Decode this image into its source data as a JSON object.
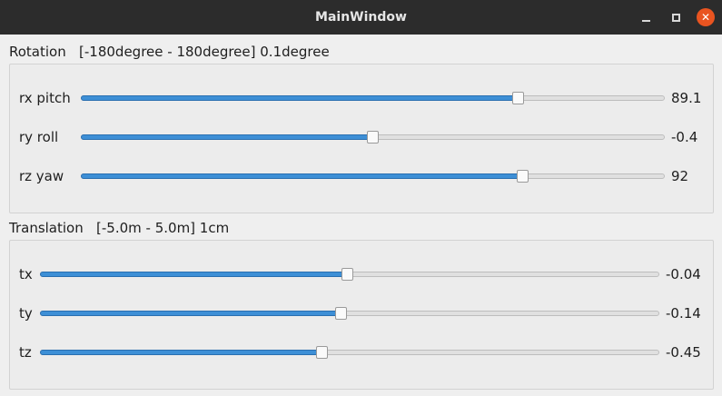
{
  "window": {
    "title": "MainWindow",
    "controls": [
      "minimize-icon",
      "maximize-icon",
      "close-icon"
    ],
    "close_glyph": "✕"
  },
  "rotation": {
    "title": "Rotation   [-180degree - 180degree] 0.1degree",
    "rows": [
      {
        "label": "rx pitch",
        "value": "89.1",
        "fraction": 0.7475
      },
      {
        "label": "ry roll",
        "value": "-0.4",
        "fraction": 0.4989
      },
      {
        "label": "rz yaw",
        "value": "92",
        "fraction": 0.7556
      }
    ]
  },
  "translation": {
    "title": "Translation   [-5.0m - 5.0m] 1cm",
    "rows": [
      {
        "label": "tx",
        "value": "-0.04",
        "fraction": 0.496
      },
      {
        "label": "ty",
        "value": "-0.14",
        "fraction": 0.486
      },
      {
        "label": "tz",
        "value": "-0.45",
        "fraction": 0.455
      }
    ]
  },
  "colors": {
    "accent": "#3d8fd6",
    "close": "#e95420",
    "titlebar": "#2c2c2c"
  }
}
